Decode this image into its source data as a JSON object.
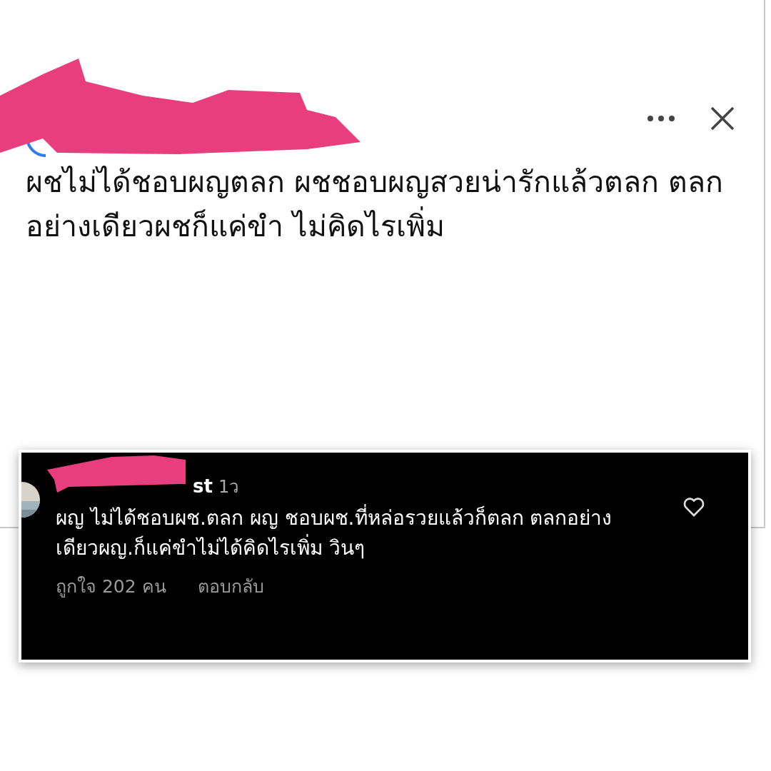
{
  "post": {
    "text": "ผชไม่ได้ชอบผญตลก ผชชอบผญสวยน่ารักแล้วตลก ตลกอย่างเดียวผชก็แค่ขำ ไม่คิดไรเพิ่ม"
  },
  "comment": {
    "username_visible": "st",
    "time": "1ว",
    "text": "ผญ ไม่ได้ชอบผช.ตลก ผญ ชอบผช.ที่หล่อรวยแล้วก็ตลก ตลกอย่างเดียวผญ.ก็แค่ขำไม่ได้คิดไรเพิ่ม วินๆ",
    "likes": "ถูกใจ 202 คน",
    "reply": "ตอบกลับ",
    "liked": false
  }
}
